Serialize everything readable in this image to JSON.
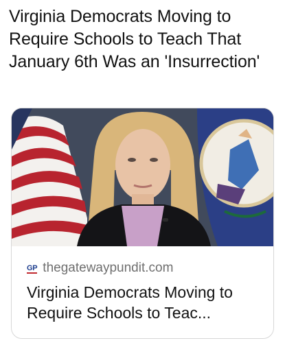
{
  "post": {
    "text": "Virginia Democrats Moving to Require Schools to Teach That January 6th Was an 'Insurrection'"
  },
  "link_card": {
    "site_logo": "GP",
    "domain": "thegatewaypundit.com",
    "title": "Virginia Democrats Moving to Require Schools to Teac...",
    "image_description_icon": "photo-thumbnail"
  },
  "colors": {
    "text": "#111111",
    "muted": "#6f6f6f",
    "card_border": "#d6d6d6",
    "logo_blue": "#1f3f8f",
    "logo_red": "#c0282e"
  }
}
